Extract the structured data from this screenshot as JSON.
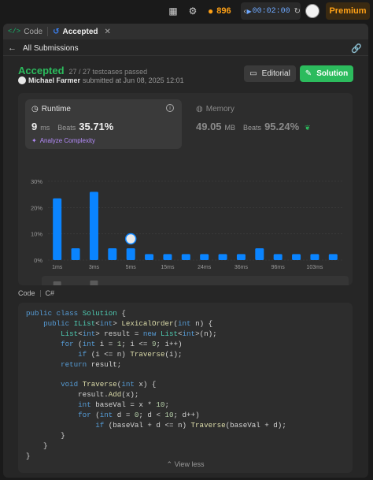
{
  "topbar": {
    "streak_count": "896",
    "timer": "00:02:00",
    "premium_label": "Premium"
  },
  "tabs": [
    {
      "label": "Code"
    },
    {
      "label": "Accepted"
    }
  ],
  "nav": {
    "all_submissions_label": "All Submissions"
  },
  "submission": {
    "status": "Accepted",
    "testcases": "27 / 27 testcases passed",
    "author": "Michael Farmer",
    "submitted_text": "submitted at Jun 08, 2025 12:01",
    "editorial_label": "Editorial",
    "solution_label": "Solution"
  },
  "runtime": {
    "label": "Runtime",
    "value": "9",
    "unit": "ms",
    "beats_label": "Beats",
    "beats_pct": "35.71%",
    "analyze_label": "Analyze Complexity"
  },
  "memory": {
    "label": "Memory",
    "value": "49.05",
    "unit": "MB",
    "beats_label": "Beats",
    "beats_pct": "95.24%"
  },
  "chart_data": {
    "type": "bar",
    "yticks": [
      "30%",
      "20%",
      "10%",
      "0%"
    ],
    "ylim": [
      0,
      30
    ],
    "values": [
      23.5,
      4.5,
      26,
      4.5,
      4.5,
      2.3,
      2.3,
      2.3,
      2.3,
      2.3,
      2.3,
      4.5,
      2.3,
      2.3,
      2.3,
      2.3
    ],
    "xticks": [
      "1ms",
      "3ms",
      "5ms",
      "15ms",
      "24ms",
      "36ms",
      "96ms",
      "103ms"
    ],
    "marker_index": 4,
    "bar_color": "#0a84ff",
    "grid": true
  },
  "code_section": {
    "label": "Code",
    "language": "C#",
    "lines": [
      "public class Solution {",
      "    public IList<int> LexicalOrder(int n) {",
      "        List<int> result = new List<int>(n);",
      "        for (int i = 1; i <= 9; i++)",
      "            if (i <= n) Traverse(i);",
      "        return result;",
      "",
      "        void Traverse(int x) {",
      "            result.Add(x);",
      "            int baseVal = x * 10;",
      "            for (int d = 0; d < 10; d++)",
      "                if (baseVal + d <= n) Traverse(baseVal + d);",
      "        }",
      "    }",
      "}"
    ],
    "view_less_label": "View less"
  }
}
